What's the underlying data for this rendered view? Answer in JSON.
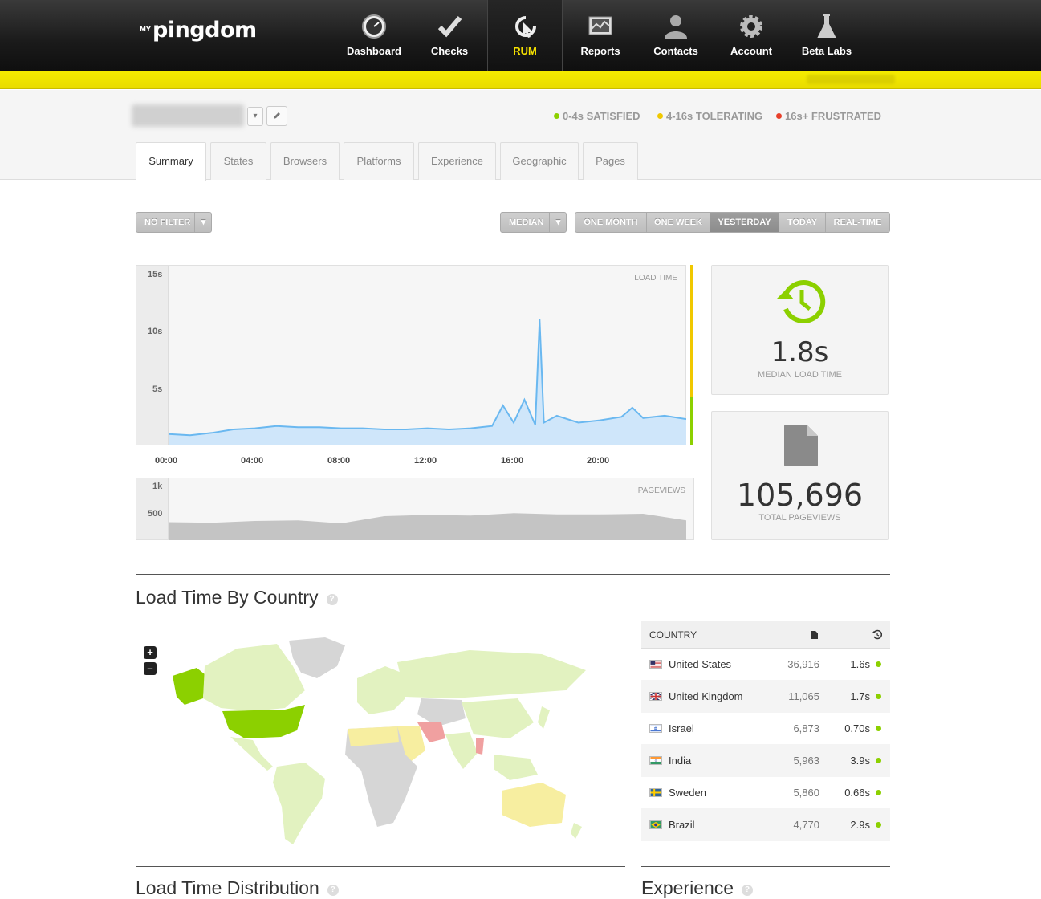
{
  "nav": {
    "logo_prefix": "MY",
    "logo": "pingdom",
    "items": [
      {
        "label": "Dashboard",
        "icon": "gauge-icon"
      },
      {
        "label": "Checks",
        "icon": "checkmark-icon"
      },
      {
        "label": "RUM",
        "icon": "rum-cursor-icon"
      },
      {
        "label": "Reports",
        "icon": "report-chart-icon"
      },
      {
        "label": "Contacts",
        "icon": "person-icon"
      },
      {
        "label": "Account",
        "icon": "gear-icon"
      },
      {
        "label": "Beta Labs",
        "icon": "flask-icon"
      }
    ],
    "active": "RUM"
  },
  "legend": {
    "satisfied": "0-4s SATISFIED",
    "tolerating": "4-16s TOLERATING",
    "frustrated": "16s+ FRUSTRATED",
    "colors": {
      "satisfied": "#8cd000",
      "tolerating": "#f0c800",
      "frustrated": "#e8402a"
    }
  },
  "tabs": [
    "Summary",
    "States",
    "Browsers",
    "Platforms",
    "Experience",
    "Geographic",
    "Pages"
  ],
  "active_tab": "Summary",
  "controls": {
    "filter": "NO FILTER",
    "aggregate": "MEDIAN",
    "ranges": [
      "ONE MONTH",
      "ONE WEEK",
      "YESTERDAY",
      "TODAY",
      "REAL-TIME"
    ],
    "active_range": "YESTERDAY"
  },
  "chart_data": [
    {
      "type": "area",
      "title": "LOAD TIME",
      "y_ticks": [
        "15s",
        "10s",
        "5s"
      ],
      "ylim": [
        0,
        15
      ],
      "x_ticks": [
        "00:00",
        "04:00",
        "08:00",
        "12:00",
        "16:00",
        "20:00"
      ],
      "x_range_hours": [
        0,
        24
      ],
      "series": [
        {
          "color": "#6ab8f0",
          "points": [
            [
              0,
              1.0
            ],
            [
              1,
              0.9
            ],
            [
              2,
              1.1
            ],
            [
              3,
              1.4
            ],
            [
              4,
              1.5
            ],
            [
              5,
              1.7
            ],
            [
              6,
              1.6
            ],
            [
              7,
              1.6
            ],
            [
              8,
              1.5
            ],
            [
              9,
              1.5
            ],
            [
              10,
              1.4
            ],
            [
              11,
              1.4
            ],
            [
              12,
              1.5
            ],
            [
              13,
              1.4
            ],
            [
              14,
              1.5
            ],
            [
              15,
              1.7
            ],
            [
              15.5,
              3.5
            ],
            [
              16,
              2.0
            ],
            [
              16.5,
              4.0
            ],
            [
              17,
              1.8
            ],
            [
              17.2,
              11.0
            ],
            [
              17.4,
              2.0
            ],
            [
              18,
              2.6
            ],
            [
              19,
              2.0
            ],
            [
              20,
              2.2
            ],
            [
              21,
              2.5
            ],
            [
              21.5,
              3.3
            ],
            [
              22,
              2.4
            ],
            [
              23,
              2.6
            ],
            [
              24,
              2.3
            ]
          ]
        }
      ]
    },
    {
      "type": "area",
      "title": "PAGEVIEWS",
      "y_ticks": [
        "1k",
        "500"
      ],
      "ylim": [
        0,
        1000
      ],
      "x_range_hours": [
        0,
        24
      ],
      "series": [
        {
          "color": "#c4c4c4",
          "points": [
            [
              0,
              300
            ],
            [
              2,
              290
            ],
            [
              4,
              320
            ],
            [
              6,
              330
            ],
            [
              8,
              280
            ],
            [
              10,
              400
            ],
            [
              12,
              420
            ],
            [
              14,
              410
            ],
            [
              16,
              450
            ],
            [
              18,
              430
            ],
            [
              20,
              430
            ],
            [
              22,
              440
            ],
            [
              24,
              330
            ]
          ]
        }
      ]
    }
  ],
  "stats": {
    "median_load_time": "1.8s",
    "median_label": "MEDIAN LOAD TIME",
    "total_pageviews": "105,696",
    "pageviews_label": "TOTAL PAGEVIEWS"
  },
  "country_section": {
    "title": "Load Time By Country",
    "help": "?",
    "zoom_in": "+",
    "zoom_out": "–",
    "table_header": {
      "country": "COUNTRY"
    },
    "rows": [
      {
        "country": "United States",
        "pageviews": "36,916",
        "load_time": "1.6s",
        "flag": "us-flag"
      },
      {
        "country": "United Kingdom",
        "pageviews": "11,065",
        "load_time": "1.7s",
        "flag": "uk-flag"
      },
      {
        "country": "Israel",
        "pageviews": "6,873",
        "load_time": "0.70s",
        "flag": "israel-flag"
      },
      {
        "country": "India",
        "pageviews": "5,963",
        "load_time": "3.9s",
        "flag": "india-flag"
      },
      {
        "country": "Sweden",
        "pageviews": "5,860",
        "load_time": "0.66s",
        "flag": "sweden-flag"
      },
      {
        "country": "Brazil",
        "pageviews": "4,770",
        "load_time": "2.9s",
        "flag": "brazil-flag"
      }
    ]
  },
  "bottom_sections": {
    "distribution": "Load Time Distribution",
    "experience": "Experience"
  }
}
